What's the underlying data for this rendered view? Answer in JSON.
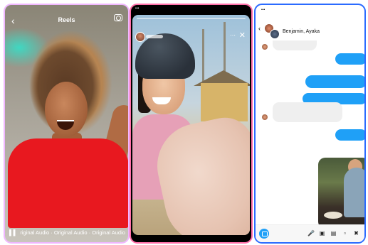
{
  "reels": {
    "title": "Reels",
    "back_icon": "chevron-left-icon",
    "camera_icon": "camera-icon",
    "audio_text": "riginal Audio · Original Audio · Original Audio"
  },
  "story": {
    "more_icon": "more-horizontal-icon",
    "close_icon": "close-icon"
  },
  "chat": {
    "conversation_name": "Benjamin, Ayaka",
    "composer_icons": [
      "camera-icon",
      "microphone-icon",
      "gallery-icon",
      "sticker-icon",
      "gif-icon",
      "close-icon"
    ]
  },
  "colors": {
    "reels_border": "#f0b6ff",
    "story_border": "#ff6fa8",
    "chat_border": "#2b6bff",
    "blue_bubble": "#1fa0f7",
    "gray_bubble": "#efefef"
  }
}
